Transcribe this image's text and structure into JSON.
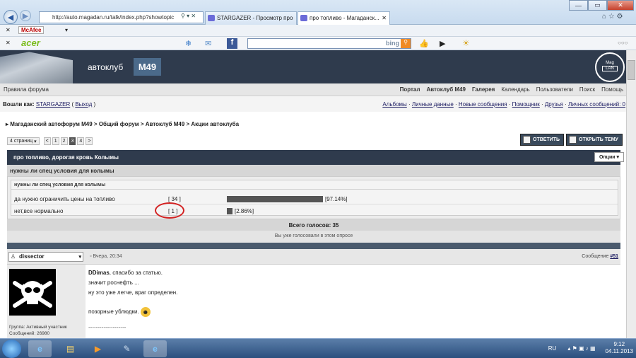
{
  "browser": {
    "address": "http://auto.magadan.ru/talk/index.php?showtopic",
    "tabs": [
      {
        "label": "STARGAZER - Просмотр про"
      },
      {
        "label": "про топливо - Магаданск..."
      }
    ],
    "toolbar1": {
      "mcafee": "McAfee"
    },
    "toolbar2": {
      "acer": "acer",
      "bing": "bing"
    }
  },
  "site": {
    "brand": "автоклуб",
    "badge": "M49",
    "logo_top": "Mag",
    "logo_bottom": "LAN",
    "forum_rules": "Правила форума",
    "menu": [
      "Портал",
      "Автоклуб M49",
      "Галерея",
      "Календарь",
      "Пользователи",
      "Поиск",
      "Помощь"
    ],
    "logged_in_prefix": "Вошли как:",
    "username": "STARGAZER",
    "logout": "Выход",
    "user_links": [
      "Альбомы",
      "Личные данные",
      "Новые сообщения",
      "Помощник",
      "Друзья",
      "Личных сообщений: 0"
    ],
    "breadcrumb": [
      "Магаданский автофорум M49",
      "Общий форум",
      "Автоклуб M49",
      "Акции автоклуба"
    ]
  },
  "pagination": {
    "label": "4 страниц",
    "prev": "<",
    "pages": [
      "1",
      "2",
      "3",
      "4"
    ],
    "current": "3",
    "next": ">"
  },
  "buttons": {
    "reply": "ОТВЕТИТЬ",
    "new_topic": "ОТКРЫТЬ ТЕМУ",
    "options": "Опции"
  },
  "topic": {
    "title": "про топливо, дорогая кровь Колымы"
  },
  "poll": {
    "question": "нужны ли спец условия для колымы",
    "subquestion": "нужны ли спец условия для колымы",
    "options": [
      {
        "label": "да нужно ограничить цены на топливо",
        "votes": "[ 34 ]",
        "percent": "[97.14%]",
        "fraction": 0.9714
      },
      {
        "label": "нет,все нормально",
        "votes": "[ 1 ]",
        "percent": "[2.86%]",
        "fraction": 0.0286
      }
    ],
    "total": "Всего голосов: 35",
    "voted": "Вы уже голосовали в этом опросе"
  },
  "post": {
    "author": "dissector",
    "date": "Вчера, 20:34",
    "number_label": "Сообщение ",
    "number": "#51",
    "group": "Группа: Активный участник",
    "messages": "Сообщений: 26980",
    "lines": [
      "значит роснефть ...",
      "ну это уже легче, враг определен."
    ],
    "mention": "DDimas",
    "mention_rest": ", спасибо за статью.",
    "last": "позорные ублюдки.",
    "sig": "--------------------"
  },
  "taskbar": {
    "lang": "RU",
    "time": "9:12",
    "date": "04.11.2013"
  }
}
